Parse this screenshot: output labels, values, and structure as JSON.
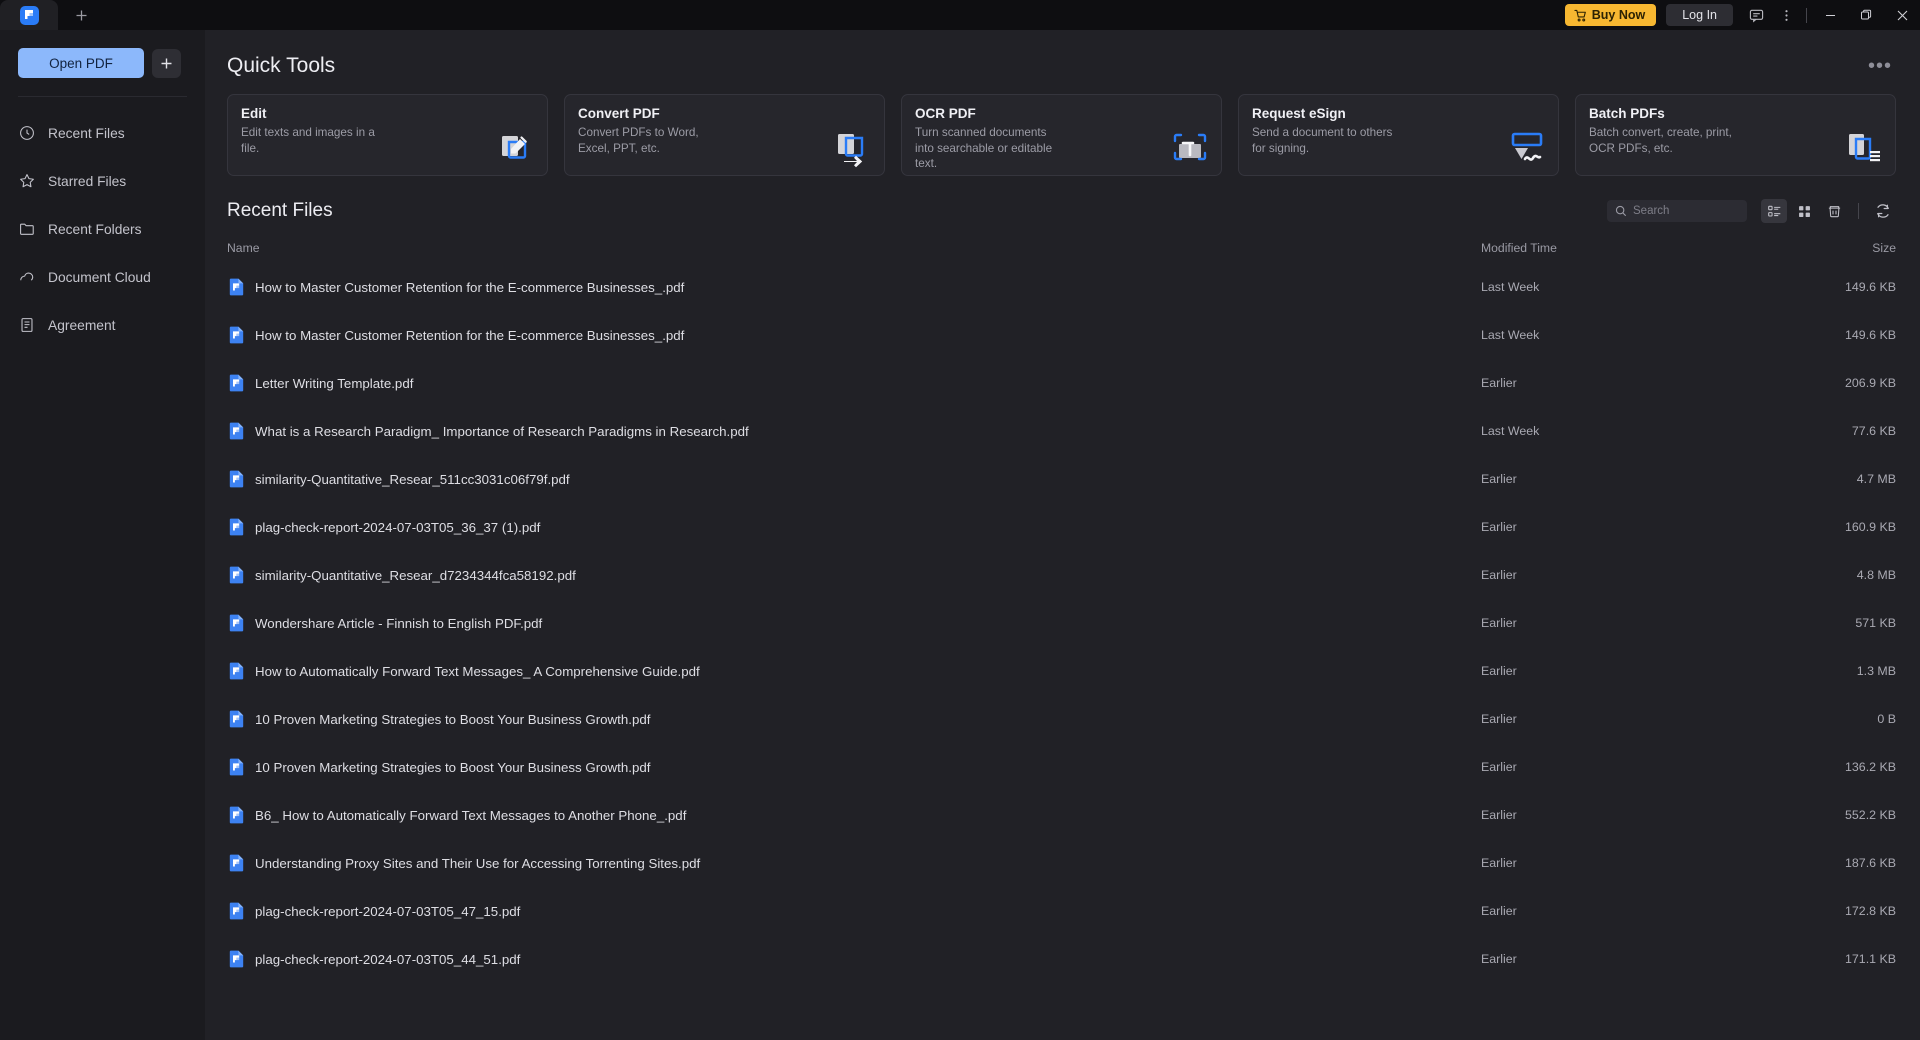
{
  "titlebar": {
    "app_logo": "wondershare-pdfelement-logo",
    "new_tab_label": "+",
    "buy_now_label": "Buy Now",
    "log_in_label": "Log In",
    "feedback_icon": "feedback-icon",
    "more_icon": "more-vertical-icon",
    "minimize_label": "minimize-icon",
    "maximize_label": "maximize-icon",
    "close_label": "close-icon",
    "accent_buy": "#f7b731"
  },
  "sidebar": {
    "open_pdf_label": "Open PDF",
    "add_label": "+",
    "items": [
      {
        "label": "Recent Files",
        "icon": "clock-icon"
      },
      {
        "label": "Starred Files",
        "icon": "star-icon"
      },
      {
        "label": "Recent Folders",
        "icon": "folder-icon"
      },
      {
        "label": "Document Cloud",
        "icon": "cloud-icon"
      },
      {
        "label": "Agreement",
        "icon": "document-icon"
      }
    ]
  },
  "quick_tools": {
    "title": "Quick Tools",
    "more_label": "•••",
    "cards": [
      {
        "title": "Edit",
        "desc": "Edit texts and images in a file.",
        "icon": "edit-document-icon"
      },
      {
        "title": "Convert PDF",
        "desc": "Convert PDFs to Word, Excel, PPT, etc.",
        "icon": "convert-arrow-icon"
      },
      {
        "title": "OCR PDF",
        "desc": "Turn scanned documents into searchable or editable text.",
        "icon": "ocr-scan-text-icon"
      },
      {
        "title": "Request eSign",
        "desc": "Send a document to others for signing.",
        "icon": "esign-signature-icon"
      },
      {
        "title": "Batch PDFs",
        "desc": "Batch convert, create, print, OCR PDFs, etc.",
        "icon": "batch-documents-icon"
      }
    ]
  },
  "recent_files": {
    "title": "Recent Files",
    "search_placeholder": "Search",
    "search_value": "",
    "toolbar": {
      "list_view": "list-view-icon",
      "grid_view": "grid-view-icon",
      "trash": "trash-icon",
      "refresh": "refresh-icon"
    },
    "columns": {
      "name": "Name",
      "modified": "Modified Time",
      "size": "Size"
    },
    "rows": [
      {
        "name": "How to Master Customer Retention for the E-commerce Businesses_.pdf",
        "modified": "Last Week",
        "size": "149.6 KB"
      },
      {
        "name": "How to Master Customer Retention for the E-commerce Businesses_.pdf",
        "modified": "Last Week",
        "size": "149.6 KB"
      },
      {
        "name": "Letter Writing Template.pdf",
        "modified": "Earlier",
        "size": "206.9 KB"
      },
      {
        "name": "What is a Research Paradigm_ Importance of Research Paradigms in Research.pdf",
        "modified": "Last Week",
        "size": "77.6 KB"
      },
      {
        "name": "similarity-Quantitative_Resear_511cc3031c06f79f.pdf",
        "modified": "Earlier",
        "size": "4.7 MB"
      },
      {
        "name": "plag-check-report-2024-07-03T05_36_37 (1).pdf",
        "modified": "Earlier",
        "size": "160.9 KB"
      },
      {
        "name": "similarity-Quantitative_Resear_d7234344fca58192.pdf",
        "modified": "Earlier",
        "size": "4.8 MB"
      },
      {
        "name": "Wondershare Article - Finnish to English PDF.pdf",
        "modified": "Earlier",
        "size": "571 KB"
      },
      {
        "name": "How to Automatically Forward Text Messages_ A Comprehensive Guide.pdf",
        "modified": "Earlier",
        "size": "1.3 MB"
      },
      {
        "name": "10 Proven Marketing Strategies to Boost Your Business Growth.pdf",
        "modified": "Earlier",
        "size": "0 B"
      },
      {
        "name": "10 Proven Marketing Strategies to Boost Your Business Growth.pdf",
        "modified": "Earlier",
        "size": "136.2 KB"
      },
      {
        "name": "B6_ How to Automatically Forward Text Messages to Another Phone_.pdf",
        "modified": "Earlier",
        "size": "552.2 KB"
      },
      {
        "name": "Understanding Proxy Sites and Their Use for Accessing Torrenting Sites.pdf",
        "modified": "Earlier",
        "size": "187.6 KB"
      },
      {
        "name": "plag-check-report-2024-07-03T05_47_15.pdf",
        "modified": "Earlier",
        "size": "172.8 KB"
      },
      {
        "name": "plag-check-report-2024-07-03T05_44_51.pdf",
        "modified": "Earlier",
        "size": "171.1 KB"
      }
    ]
  }
}
